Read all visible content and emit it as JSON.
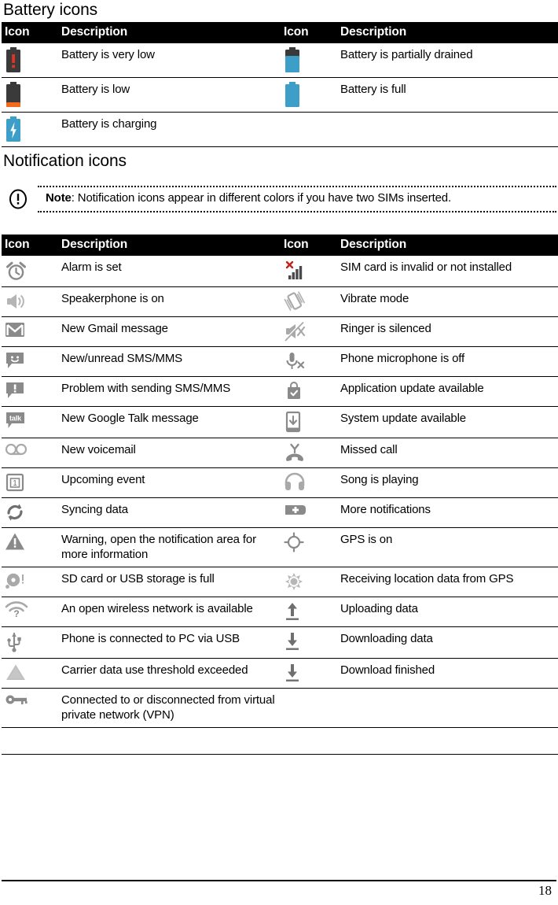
{
  "document": {
    "page_number": "18"
  },
  "battery_section": {
    "title": "Battery icons",
    "headers": {
      "icon_left": "Icon",
      "desc_left": "Description",
      "icon_right": "Icon",
      "desc_right": "Description"
    },
    "rows": [
      {
        "left": {
          "icon": "battery-very-low-icon",
          "desc": "Battery is very low"
        },
        "right": {
          "icon": "battery-partial-icon",
          "desc": "Battery is partially drained"
        }
      },
      {
        "left": {
          "icon": "battery-low-icon",
          "desc": "Battery is low"
        },
        "right": {
          "icon": "battery-full-icon",
          "desc": "Battery is full"
        }
      },
      {
        "left": {
          "icon": "battery-charging-icon",
          "desc": "Battery is charging"
        },
        "right": {
          "icon": "",
          "desc": ""
        }
      }
    ]
  },
  "notification_section": {
    "title": "Notification icons",
    "note": {
      "icon": "note-exclamation-icon",
      "label": "Note",
      "separator": ": ",
      "text": "Notification icons appear in different colors if you have two SIMs inserted.",
      "full": "Note: Notification icons appear in different colors if you have two SIMs inserted."
    },
    "headers": {
      "icon_left": "Icon",
      "desc_left": "Description",
      "icon_right": "Icon",
      "desc_right": "Description"
    },
    "rows": [
      {
        "left": {
          "icon": "alarm-clock-icon",
          "desc": "Alarm is set"
        },
        "right": {
          "icon": "sim-card-invalid-icon",
          "desc": "SIM card is invalid or not installed"
        }
      },
      {
        "left": {
          "icon": "speakerphone-icon",
          "desc": "Speakerphone is on"
        },
        "right": {
          "icon": "vibrate-mode-icon",
          "desc": "Vibrate mode"
        }
      },
      {
        "left": {
          "icon": "gmail-icon",
          "desc": "New Gmail message"
        },
        "right": {
          "icon": "ringer-silenced-icon",
          "desc": "Ringer is silenced"
        }
      },
      {
        "left": {
          "icon": "sms-mms-icon",
          "desc": "New/unread SMS/MMS"
        },
        "right": {
          "icon": "microphone-off-icon",
          "desc": "Phone microphone is off"
        }
      },
      {
        "left": {
          "icon": "sms-problem-icon",
          "desc": "Problem with sending SMS/MMS"
        },
        "right": {
          "icon": "app-update-icon",
          "desc": "Application update available"
        }
      },
      {
        "left": {
          "icon": "google-talk-icon",
          "desc": "New Google Talk message"
        },
        "right": {
          "icon": "system-update-icon",
          "desc": "System update available"
        }
      },
      {
        "left": {
          "icon": "voicemail-icon",
          "desc": "New voicemail"
        },
        "right": {
          "icon": "missed-call-icon",
          "desc": "Missed call"
        }
      },
      {
        "left": {
          "icon": "calendar-event-icon",
          "desc": "Upcoming event"
        },
        "right": {
          "icon": "headphones-icon",
          "desc": "Song is playing"
        }
      },
      {
        "left": {
          "icon": "sync-icon",
          "desc": "Syncing data"
        },
        "right": {
          "icon": "more-notifications-icon",
          "desc": "More notifications"
        }
      },
      {
        "left": {
          "icon": "warning-triangle-icon",
          "desc": "Warning, open the notification area for more information"
        },
        "right": {
          "icon": "gps-on-icon",
          "desc": "GPS is on"
        }
      },
      {
        "left": {
          "icon": "sd-card-full-icon",
          "desc": "SD card or USB storage is full"
        },
        "right": {
          "icon": "gps-receiving-icon",
          "desc": "Receiving location data from GPS"
        }
      },
      {
        "left": {
          "icon": "open-wifi-icon",
          "desc": "An open wireless network is available"
        },
        "right": {
          "icon": "upload-icon",
          "desc": "Uploading data"
        }
      },
      {
        "left": {
          "icon": "usb-icon",
          "desc": "Phone is connected to PC via USB"
        },
        "right": {
          "icon": "download-icon",
          "desc": "Downloading data"
        }
      },
      {
        "left": {
          "icon": "carrier-data-icon",
          "desc": "Carrier data use threshold exceeded"
        },
        "right": {
          "icon": "download-finished-icon",
          "desc": "Download finished"
        }
      },
      {
        "left": {
          "icon": "vpn-key-icon",
          "desc": "Connected to or disconnected from virtual private network (VPN)"
        },
        "right": {
          "icon": "",
          "desc": ""
        }
      }
    ]
  },
  "colors": {
    "battery_red": "#e03323",
    "battery_dark": "#3a3a3a",
    "battery_orange": "#f26a1b",
    "battery_blue": "#3d9fc8",
    "icon_gray": "#8a8a8a",
    "header_bg": "#000000",
    "header_fg": "#ffffff",
    "sim_x_red": "#c22018",
    "sim_bars": "#4a4a4a"
  }
}
